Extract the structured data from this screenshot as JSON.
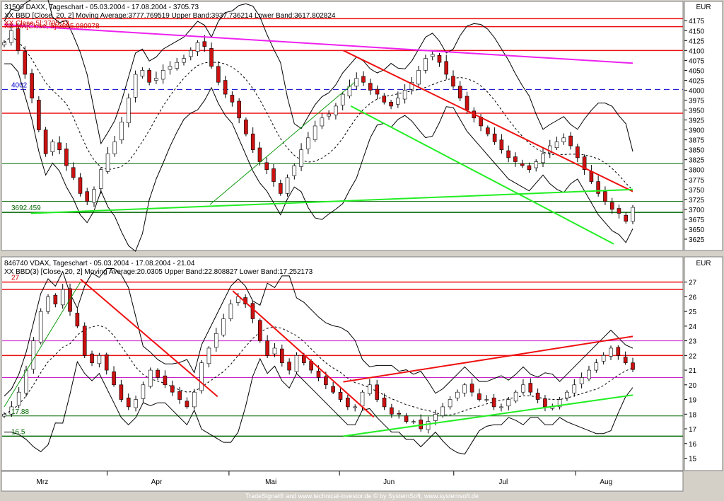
{
  "panels": [
    {
      "id": "top",
      "title": "31500  DAXX, Tageschart - 05.03.2004 - 17.08.2004 - 3705.73",
      "indicator_1": "XX BBD [Close, 20, 2] Moving Average:3777.769519 Upper Band:3937.736214 Lower Band:3617.802824",
      "indicator_2": "XX Close,5]:3705.73",
      "indicator_3": "XX MA[Close, 5]:3695.080978",
      "currency": "EUR",
      "left_labels": [
        {
          "text": "4002",
          "value": 4002
        },
        {
          "text": "3692.459",
          "value": 3692.459
        }
      ]
    },
    {
      "id": "bottom",
      "title": "846740  VDAX, Tageschart - 05.03.2004 - 17.08.2004 - 21.04",
      "indicator_1": "XX BBD(3) [Close, 20, 2] Moving Average:20.0305 Upper Band:22.808827 Lower Band:17.252173",
      "currency": "EUR",
      "left_labels": [
        {
          "text": "27",
          "value": 27
        },
        {
          "text": "17.88",
          "value": 17.88
        },
        {
          "text": "16.5",
          "value": 16.5
        }
      ]
    }
  ],
  "x_axis": {
    "month_labels": [
      "Mrz",
      "Apr",
      "Mai",
      "Jun",
      "Jul",
      "Aug"
    ]
  },
  "footer": "TradeSignal® and www.technical-investor.de © by SystemSoft, www.systemsoft.de",
  "colors": {
    "background": "#ffffff",
    "chrome": "#d4d0c8",
    "rising": "#ffffff",
    "falling": "#cc1111",
    "resistance": "#ee1111",
    "trendline_magenta": "#ee22ee",
    "support_green": "#22ee22",
    "level_green": "#006600",
    "dashed_blue": "#0000cc"
  },
  "chart_data": [
    {
      "type": "candlestick",
      "title": "31500  DAXX, Tageschart - 05.03.2004 - 17.08.2004 - 3705.73",
      "xlabel": "",
      "ylabel": "",
      "ylim": [
        3600,
        4195
      ],
      "yticks": [
        3625,
        3650,
        3675,
        3700,
        3725,
        3750,
        3775,
        3800,
        3825,
        3850,
        3875,
        3900,
        3925,
        3950,
        3975,
        4000,
        4025,
        4050,
        4075,
        4100,
        4125,
        4150,
        4175
      ],
      "month_ticks": [
        "Mrz",
        "Apr",
        "Mai",
        "Jun",
        "Jul",
        "Aug"
      ],
      "close_path": [
        4120,
        4150,
        4100,
        4040,
        3980,
        3900,
        3840,
        3870,
        3850,
        3810,
        3780,
        3740,
        3720,
        3750,
        3800,
        3840,
        3870,
        3920,
        3980,
        4040,
        4050,
        4020,
        4030,
        4050,
        4060,
        4070,
        4080,
        4100,
        4120,
        4110,
        4060,
        4020,
        3990,
        3970,
        3930,
        3890,
        3850,
        3820,
        3800,
        3770,
        3740,
        3780,
        3810,
        3850,
        3880,
        3910,
        3930,
        3940,
        3960,
        3990,
        4010,
        4030,
        4020,
        4000,
        3990,
        3970,
        3960,
        3980,
        4000,
        4020,
        4050,
        4080,
        4090,
        4070,
        4040,
        4010,
        3980,
        3950,
        3930,
        3910,
        3890,
        3870,
        3850,
        3830,
        3820,
        3810,
        3800,
        3820,
        3840,
        3860,
        3870,
        3880,
        3860,
        3830,
        3800,
        3770,
        3740,
        3720,
        3700,
        3690,
        3670,
        3705
      ],
      "horizontal_levels": [
        {
          "value": 4180,
          "color": "red"
        },
        {
          "value": 4160,
          "color": "red"
        },
        {
          "value": 4100,
          "color": "red"
        },
        {
          "value": 4002,
          "color": "blue-dashed"
        },
        {
          "value": 3942,
          "color": "red"
        },
        {
          "value": 3815,
          "color": "green"
        },
        {
          "value": 3720,
          "color": "green"
        },
        {
          "value": 3692.459,
          "color": "dark-green"
        }
      ],
      "trendlines": [
        {
          "color": "magenta",
          "from": {
            "date": "2004-03-05",
            "value": 4165
          },
          "to": {
            "date": "2004-08-17",
            "value": 4068
          }
        },
        {
          "color": "red",
          "from": {
            "date": "2004-06-02",
            "value": 4100
          },
          "to": {
            "date": "2004-08-17",
            "value": 3745
          }
        },
        {
          "color": "lime",
          "from": {
            "date": "2004-06-04",
            "value": 3960
          },
          "to": {
            "date": "2004-08-12",
            "value": 3613
          }
        },
        {
          "color": "lime",
          "from": {
            "date": "2004-03-12",
            "value": 3690
          },
          "to": {
            "date": "2004-08-17",
            "value": 3750
          }
        },
        {
          "color": "green",
          "from": {
            "date": "2004-04-28",
            "value": 3712
          },
          "to": {
            "date": "2004-06-05",
            "value": 4020
          }
        }
      ]
    },
    {
      "type": "candlestick",
      "title": "846740  VDAX, Tageschart - 05.03.2004 - 17.08.2004 - 21.04",
      "xlabel": "",
      "ylabel": "",
      "ylim": [
        14.3,
        27.9
      ],
      "yticks": [
        15,
        16,
        17,
        18,
        19,
        20,
        21,
        22,
        23,
        24,
        25,
        26,
        27
      ],
      "month_ticks": [
        "Mrz",
        "Apr",
        "Mai",
        "Jun",
        "Jul",
        "Aug"
      ],
      "close_path": [
        18.0,
        18.5,
        19.5,
        21.0,
        23.0,
        25.0,
        26.0,
        25.5,
        26.5,
        25.0,
        24.0,
        22.0,
        21.5,
        22.0,
        21.0,
        20.0,
        19.0,
        18.5,
        19.0,
        20.0,
        21.0,
        20.5,
        20.0,
        19.5,
        19.0,
        18.5,
        19.5,
        21.5,
        22.5,
        23.5,
        24.5,
        25.5,
        26.0,
        25.5,
        24.5,
        23.0,
        22.0,
        22.5,
        21.5,
        21.0,
        22.0,
        21.5,
        21.0,
        20.5,
        20.0,
        19.5,
        19.0,
        18.5,
        18.5,
        19.5,
        20.0,
        19.0,
        18.5,
        18.0,
        18.0,
        17.5,
        17.5,
        17.0,
        17.5,
        18.0,
        18.5,
        19.0,
        19.5,
        20.0,
        19.5,
        19.0,
        19.0,
        18.5,
        18.5,
        19.0,
        19.5,
        20.0,
        19.5,
        19.0,
        18.5,
        18.5,
        19.0,
        19.5,
        20.0,
        20.5,
        21.0,
        21.5,
        22.0,
        22.5,
        22.0,
        21.5,
        21.04
      ],
      "horizontal_levels": [
        {
          "value": 27,
          "color": "red"
        },
        {
          "value": 26.5,
          "color": "red"
        },
        {
          "value": 23.0,
          "color": "magenta"
        },
        {
          "value": 22.0,
          "color": "red"
        },
        {
          "value": 20.5,
          "color": "magenta"
        },
        {
          "value": 17.88,
          "color": "green"
        },
        {
          "value": 16.5,
          "color": "dark-green"
        }
      ],
      "trendlines": [
        {
          "color": "red",
          "from": {
            "date": "2004-03-25",
            "value": 27.2
          },
          "to": {
            "date": "2004-04-30",
            "value": 19.2
          }
        },
        {
          "color": "red",
          "from": {
            "date": "2004-05-04",
            "value": 26.4
          },
          "to": {
            "date": "2004-06-10",
            "value": 17.8
          }
        },
        {
          "color": "red",
          "from": {
            "date": "2004-06-02",
            "value": 20.2
          },
          "to": {
            "date": "2004-08-17",
            "value": 23.3
          }
        },
        {
          "color": "lime",
          "from": {
            "date": "2004-06-02",
            "value": 16.5
          },
          "to": {
            "date": "2004-08-17",
            "value": 19.3
          }
        },
        {
          "color": "green",
          "from": {
            "date": "2004-03-05",
            "value": 18.5
          },
          "to": {
            "date": "2004-03-25",
            "value": 27.0
          }
        }
      ]
    }
  ]
}
